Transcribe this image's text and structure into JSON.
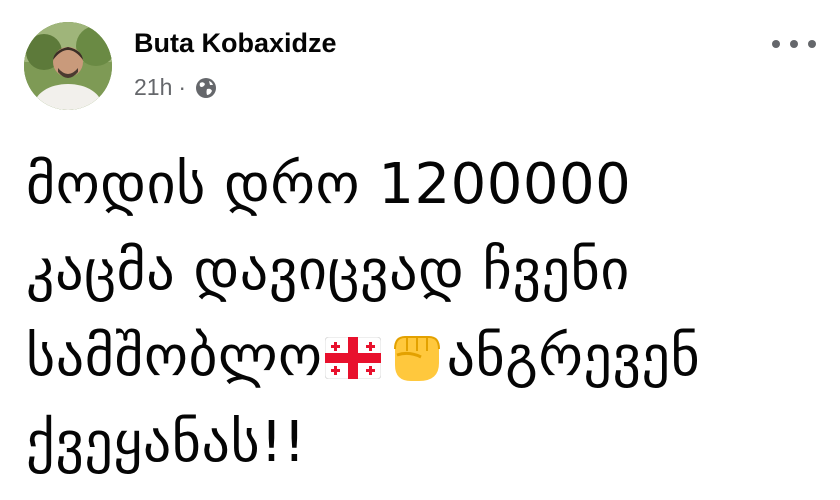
{
  "post": {
    "author": "Buta Kobaxidze",
    "time": "21h",
    "separator": "·",
    "audience_icon": "globe-icon",
    "more_icon": "more-dots-icon",
    "text_lines": {
      "line1": "მოდის დრო 1200000",
      "line2": "კაცმა დავიცვად ჩვენი",
      "line3_a": "სამშობლო",
      "line3_flag": "georgia-flag-emoji",
      "line3_fist": "raised-fist-emoji",
      "line3_b": "ანგრევენ",
      "line4": "ქვეყანას!!"
    }
  },
  "colors": {
    "name": "#050505",
    "meta": "#65676b",
    "flag_red": "#e8112d",
    "fist_yellow": "#ffc83d"
  }
}
